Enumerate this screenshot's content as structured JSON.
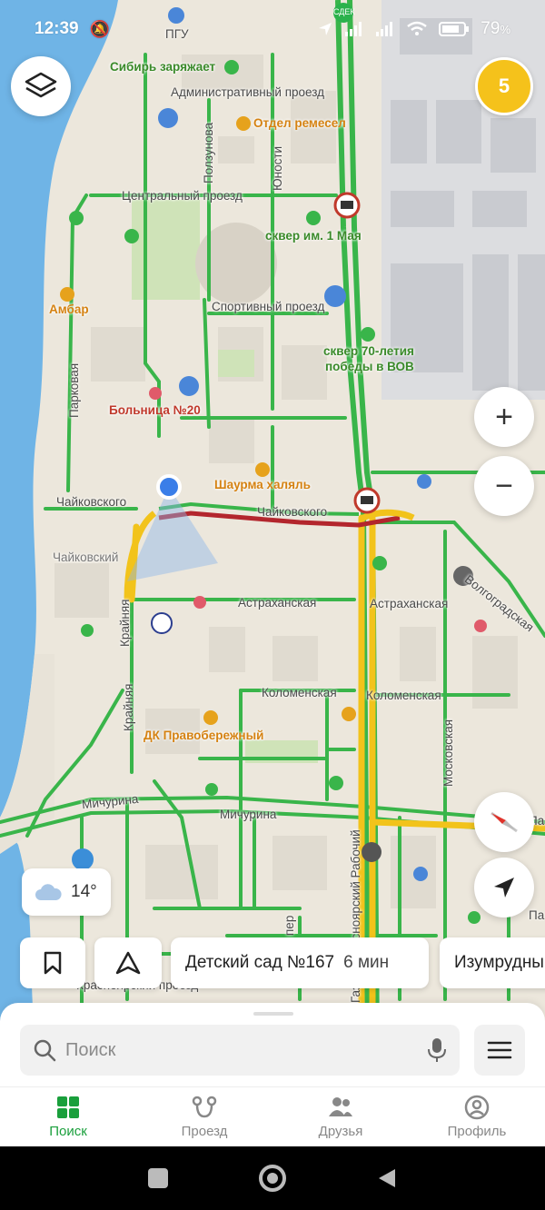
{
  "status_bar": {
    "time": "12:39",
    "battery": "79",
    "battery_unit": "%"
  },
  "map": {
    "pois": [
      {
        "id": "pgu",
        "label": "ПГУ"
      },
      {
        "id": "sdek",
        "label": "СДЕК"
      },
      {
        "id": "siberia",
        "label": "Сибирь заряжает"
      },
      {
        "id": "adm",
        "label": "Административный проезд"
      },
      {
        "id": "remesel",
        "label": "Отдел ремесел"
      },
      {
        "id": "polzunova",
        "label": "Ползунова"
      },
      {
        "id": "yunosti",
        "label": "Юности"
      },
      {
        "id": "central",
        "label": "Центральный проезд"
      },
      {
        "id": "skver1may",
        "label": "сквер им. 1 Мая"
      },
      {
        "id": "ambar",
        "label": "Амбар"
      },
      {
        "id": "sport",
        "label": "Спортивный проезд"
      },
      {
        "id": "skver70a",
        "label": "сквер 70-летия"
      },
      {
        "id": "skver70b",
        "label": "победы в ВОВ"
      },
      {
        "id": "parkovaya",
        "label": "Парковая"
      },
      {
        "id": "hospital",
        "label": "Больница №20"
      },
      {
        "id": "shaurma",
        "label": "Шаурма халяль"
      },
      {
        "id": "chaik1",
        "label": "Чайковского"
      },
      {
        "id": "chaik2",
        "label": "Чайковского"
      },
      {
        "id": "chaikovsky",
        "label": "Чайковский"
      },
      {
        "id": "volgograd",
        "label": "Волгоградская"
      },
      {
        "id": "astr1",
        "label": "Астраханская"
      },
      {
        "id": "astr2",
        "label": "Астраханская"
      },
      {
        "id": "krainyaya1",
        "label": "Крайняя"
      },
      {
        "id": "krainyaya2",
        "label": "Крайняя"
      },
      {
        "id": "kolom1",
        "label": "Коломенская"
      },
      {
        "id": "kolom2",
        "label": "Коломенская"
      },
      {
        "id": "dk",
        "label": "ДК Правобережный"
      },
      {
        "id": "moskovskaya",
        "label": "Московская"
      },
      {
        "id": "krasrab",
        "label": "Газеты Красноярский Рабочий"
      },
      {
        "id": "mich1",
        "label": "Мичурина"
      },
      {
        "id": "mich2",
        "label": "Мичурина"
      },
      {
        "id": "kraspr",
        "label": "Красноярский проезд"
      },
      {
        "id": "per",
        "label": "пер"
      },
      {
        "id": "pa1",
        "label": "Па"
      },
      {
        "id": "pa2",
        "label": "Па"
      }
    ]
  },
  "layers_button": {
    "icon": "layers-icon"
  },
  "badge": {
    "count": "5"
  },
  "zoom": {
    "in": "+",
    "out": "−"
  },
  "weather": {
    "temp": "14°",
    "icon": "cloud-icon"
  },
  "chips": [
    {
      "icon": "bookmark-icon"
    },
    {
      "icon": "route-arrow-icon"
    },
    {
      "label": "Детский сад №167",
      "time": "6 мин"
    },
    {
      "label": "Изумрудный"
    }
  ],
  "search": {
    "placeholder": "Поиск"
  },
  "tabs": [
    {
      "label": "Поиск",
      "icon": "grid-icon",
      "active": true
    },
    {
      "label": "Проезд",
      "icon": "route-icon",
      "active": false
    },
    {
      "label": "Друзья",
      "icon": "friends-icon",
      "active": false
    },
    {
      "label": "Профиль",
      "icon": "profile-icon",
      "active": false
    }
  ],
  "colors": {
    "accent": "#1a9f3c",
    "badge": "#f5c21b",
    "water": "#6fb4e6",
    "road_green": "#39b54a",
    "road_yellow": "#f2c31b",
    "road_red": "#b3262d"
  }
}
